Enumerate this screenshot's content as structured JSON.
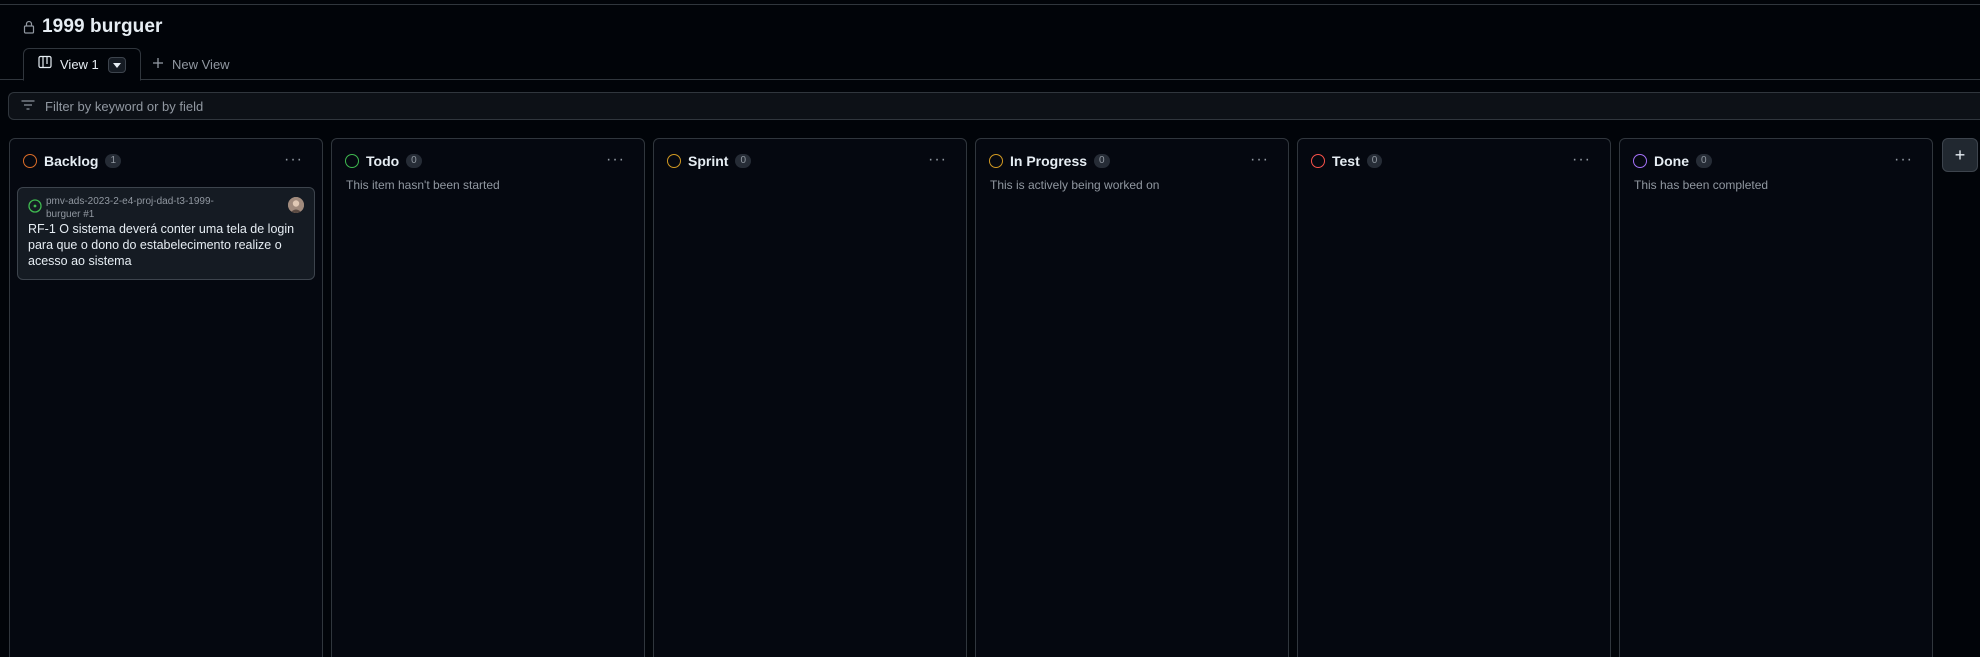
{
  "project": {
    "title": "1999 burguer"
  },
  "tabs": {
    "active_label": "View 1",
    "new_view_label": "New View"
  },
  "filter": {
    "placeholder": "Filter by keyword or by field"
  },
  "columns": [
    {
      "name": "Backlog",
      "count": "1",
      "description": "",
      "color": "#db6d28",
      "cards": [
        {
          "repo": "pmv-ads-2023-2-e4-proj-dad-t3-1999-burguer #1",
          "title": "RF-1 O sistema deverá conter uma tela de login para que o dono do estabelecimento realize o acesso ao sistema"
        }
      ]
    },
    {
      "name": "Todo",
      "count": "0",
      "description": "This item hasn't been started",
      "color": "#3fb950",
      "cards": []
    },
    {
      "name": "Sprint",
      "count": "0",
      "description": "",
      "color": "#d29922",
      "cards": []
    },
    {
      "name": "In Progress",
      "count": "0",
      "description": "This is actively being worked on",
      "color": "#d29922",
      "cards": []
    },
    {
      "name": "Test",
      "count": "0",
      "description": "",
      "color": "#f85149",
      "cards": []
    },
    {
      "name": "Done",
      "count": "0",
      "description": "This has been completed",
      "color": "#a371f7",
      "cards": []
    }
  ],
  "icons": {
    "lock": "lock-icon",
    "board": "board-icon",
    "dropdown": "triangle-down-icon",
    "plus": "plus-icon",
    "filter": "filter-icon",
    "more": "kebab-horizontal-icon",
    "issue": "issue-opened-icon"
  },
  "add_column_label": "+"
}
